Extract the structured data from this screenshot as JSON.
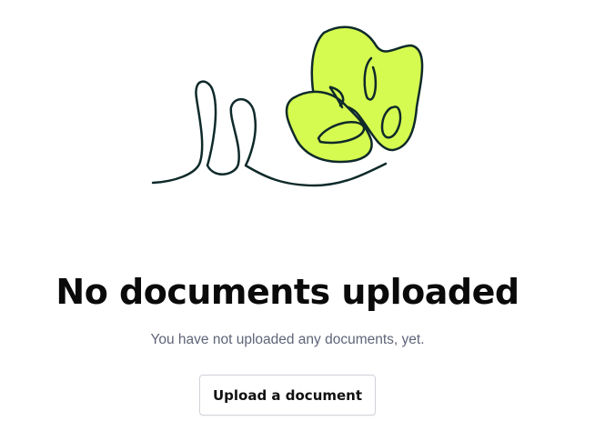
{
  "empty_state": {
    "illustration": "scribble-butterfly-illustration",
    "title": "No documents uploaded",
    "subtitle": "You have not uploaded any documents, yet.",
    "upload_button_label": "Upload a document"
  },
  "colors": {
    "accent_fill": "#d6fb50",
    "stroke": "#0f2a2a",
    "text_primary": "#0a0a0a",
    "text_secondary": "#5f6478",
    "button_border": "#d0d3d9"
  }
}
